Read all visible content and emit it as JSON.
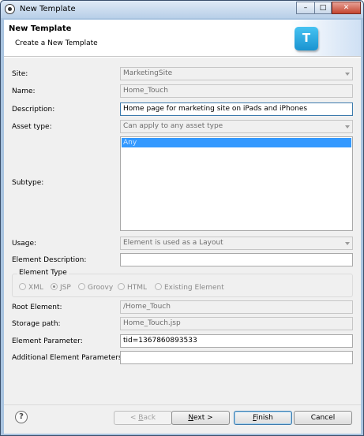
{
  "window": {
    "title": "New Template",
    "controls": [
      "minimize",
      "maximize",
      "close"
    ]
  },
  "header": {
    "title": "New Template",
    "subtitle": "Create a New Template",
    "icon_letter": "T"
  },
  "form": {
    "site": {
      "label": "Site:",
      "value": "MarketingSite"
    },
    "name": {
      "label": "Name:",
      "value": "Home_Touch"
    },
    "description": {
      "label": "Description:",
      "value": "Home page for marketing site on iPads and iPhones"
    },
    "asset_type": {
      "label": "Asset type:",
      "value": "Can apply to any asset type"
    },
    "subtype": {
      "label": "Subtype:",
      "items": [
        "Any"
      ]
    },
    "usage": {
      "label": "Usage:",
      "value": "Element is used as a Layout"
    },
    "element_description": {
      "label": "Element Description:",
      "value": ""
    },
    "element_type": {
      "legend": "Element Type",
      "options": [
        "XML",
        "JSP",
        "Groovy",
        "HTML",
        "Existing Element"
      ],
      "selected": "JSP"
    },
    "root_element": {
      "label": "Root Element:",
      "value": "/Home_Touch"
    },
    "storage_path": {
      "label": "Storage path:",
      "value": "Home_Touch.jsp"
    },
    "element_parameter": {
      "label": "Element Parameter:",
      "value": "tid=1367860893533"
    },
    "additional_parameters": {
      "label": "Additional Element Parameters:",
      "value": ""
    }
  },
  "footer": {
    "help_glyph": "?",
    "back": {
      "mnemonic": "B",
      "rest": "ack",
      "prefix": "< "
    },
    "next": {
      "mnemonic": "N",
      "rest": "ext >"
    },
    "finish": {
      "mnemonic": "F",
      "rest": "inish"
    },
    "cancel": "Cancel"
  },
  "colors": {
    "title_bar": "#b8cfe8",
    "selection": "#3399ff",
    "icon_blue": "#1a93d0"
  }
}
